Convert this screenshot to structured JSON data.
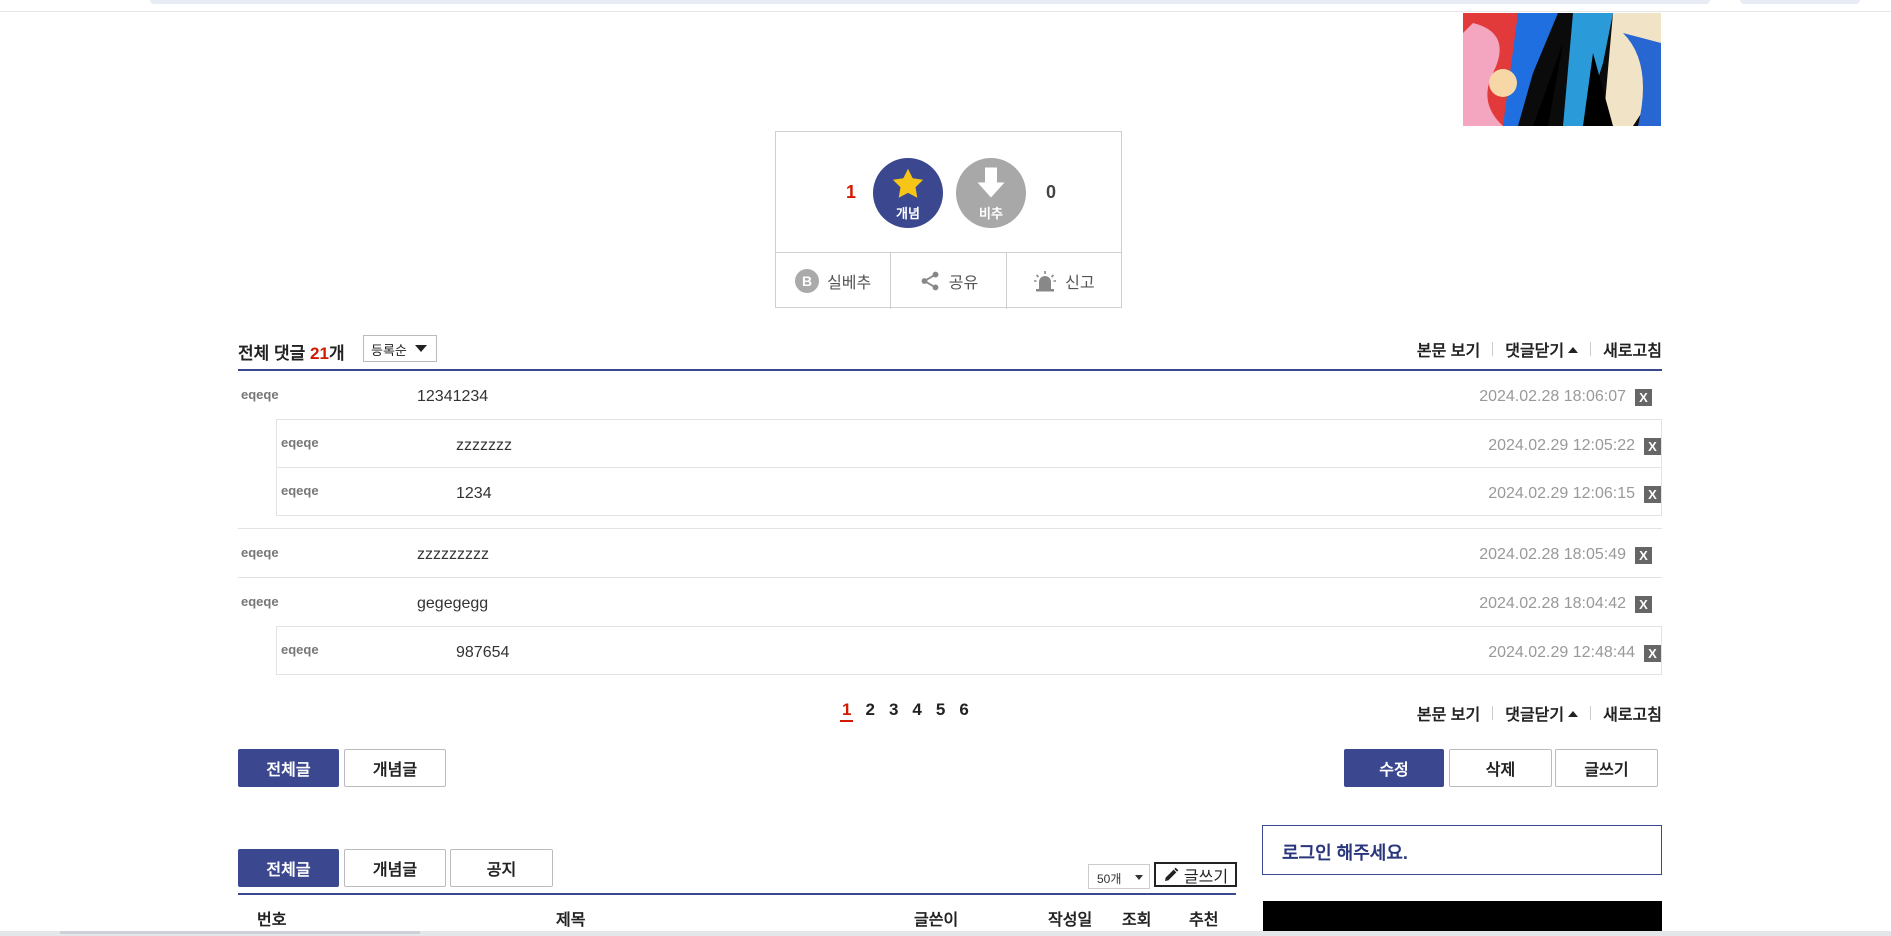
{
  "vote": {
    "up_count": "1",
    "up_label": "개념",
    "down_count": "0",
    "down_label": "비추",
    "actions": [
      "실베추",
      "공유",
      "신고"
    ]
  },
  "comments": {
    "title": "전체 댓글",
    "count": "21",
    "count_unit": "개",
    "sort": "등록순",
    "links": {
      "view_post": "본문 보기",
      "close": "댓글닫기",
      "refresh": "새로고침"
    },
    "groups": [
      {
        "nick": "eqeqe",
        "text": "12341234",
        "date": "2024.02.28 18:06:07",
        "replies": [
          {
            "nick": "eqeqe",
            "text": "zzzzzzz",
            "date": "2024.02.29 12:05:22"
          },
          {
            "nick": "eqeqe",
            "text": "1234",
            "date": "2024.02.29 12:06:15"
          }
        ]
      },
      {
        "nick": "eqeqe",
        "text": "zzzzzzzzz",
        "date": "2024.02.28 18:05:49",
        "replies": []
      },
      {
        "nick": "eqeqe",
        "text": "gegegegg",
        "date": "2024.02.28 18:04:42",
        "replies": [
          {
            "nick": "eqeqe",
            "text": "987654",
            "date": "2024.02.29 12:48:44"
          }
        ]
      }
    ],
    "delete_label": "X",
    "pages": [
      "1",
      "2",
      "3",
      "4",
      "5",
      "6"
    ],
    "current_page": "1"
  },
  "post_buttons": {
    "all": "전체글",
    "recommended": "개념글",
    "edit": "수정",
    "delete": "삭제",
    "write": "글쓰기"
  },
  "list": {
    "tabs": [
      "전체글",
      "개념글",
      "공지"
    ],
    "per_page": "50개",
    "write": "글쓰기",
    "headers": {
      "no": "번호",
      "title": "제목",
      "author": "글쓴이",
      "date": "작성일",
      "views": "조회",
      "recommend": "추천"
    }
  },
  "sidebar": {
    "login_prompt": "로그인 해주세요."
  },
  "colors": {
    "brand": "#3b4890",
    "accent_red": "#d31900"
  }
}
